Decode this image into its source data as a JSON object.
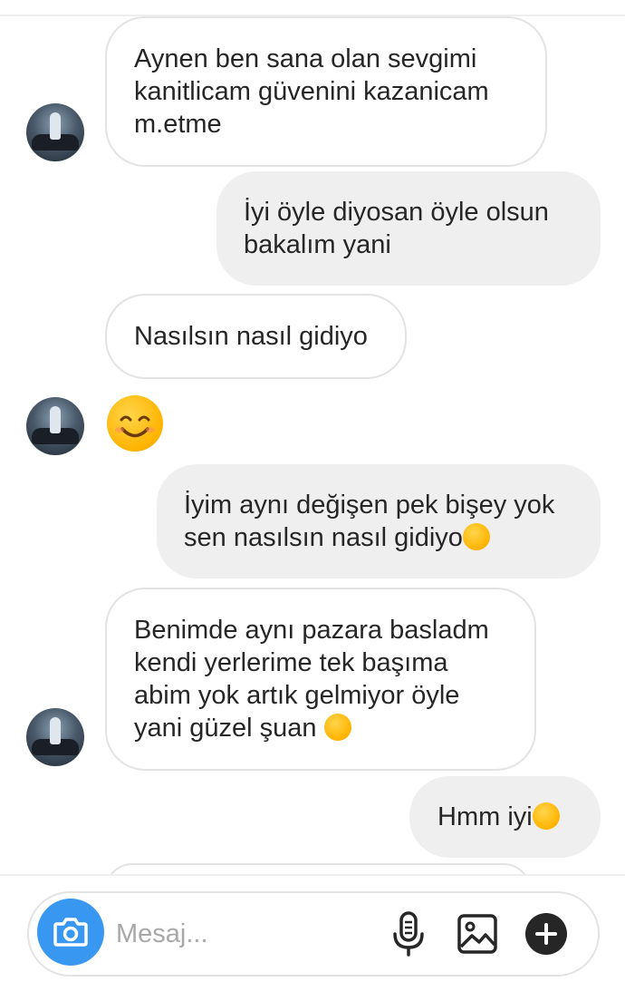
{
  "messages": [
    {
      "direction": "incoming",
      "lines": [
        "Aynen ben sana olan sevgimi",
        "kanitlicam güvenini kazanicam",
        "m.etme"
      ]
    },
    {
      "direction": "outgoing",
      "lines": [
        "İyi öyle diyosan öyle olsun",
        "bakalım yani"
      ]
    },
    {
      "direction": "incoming",
      "lines": [
        "Nasılsın nasıl gidiyo"
      ]
    },
    {
      "direction": "incoming",
      "emoji": "smiling-face-emoji"
    },
    {
      "direction": "outgoing",
      "lines": [
        "İyim aynı değişen pek bişey yok",
        "sen nasılsın nasıl gidiyo"
      ],
      "trailing_emoji": "smiling-face-emoji"
    },
    {
      "direction": "incoming",
      "lines": [
        "Benimde aynı pazara basladm",
        "kendi yerlerime tek başıma",
        "abim yok artık gelmiyor öyle",
        "yani güzel şuan"
      ],
      "trailing_emoji": "tears-of-joy-emoji"
    },
    {
      "direction": "outgoing",
      "lines": [
        "Hmm iyi"
      ],
      "trailing_emoji": "tears-of-joy-emoji"
    }
  ],
  "composer": {
    "placeholder": "Mesaj...",
    "icons": [
      "camera-icon",
      "microphone-icon",
      "gallery-icon",
      "plus-icon"
    ]
  },
  "colors": {
    "accent": "#3897f0",
    "outgoing_bubble": "#efefef",
    "incoming_border": "#e3e3e3",
    "text": "#262626"
  }
}
